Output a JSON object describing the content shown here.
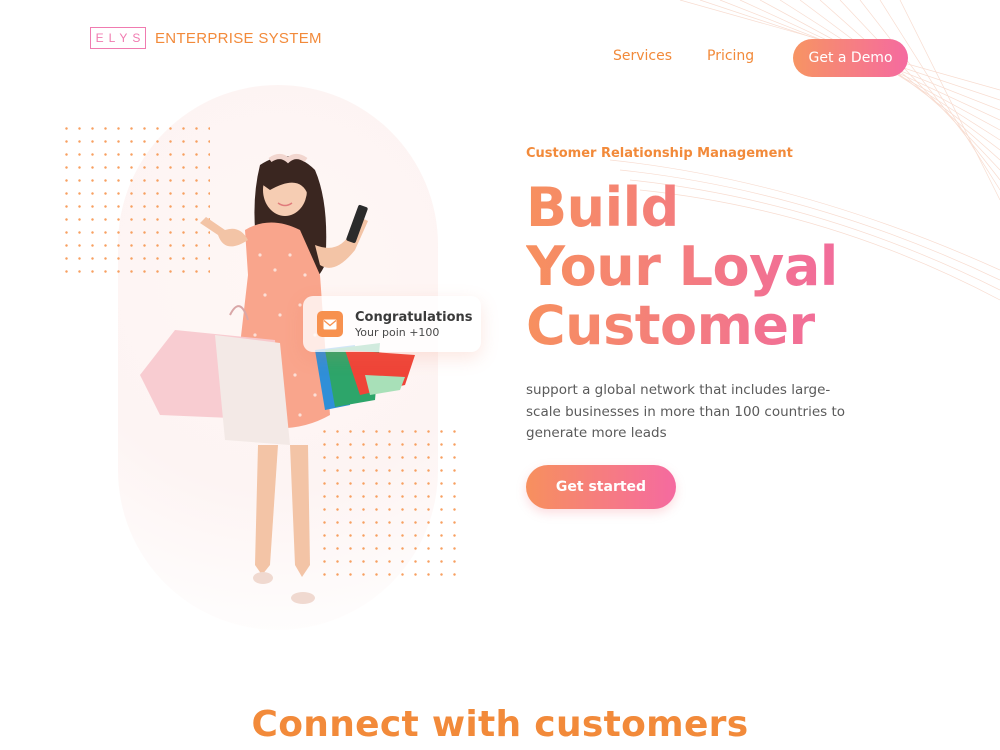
{
  "header": {
    "logo": "ELYS",
    "brand": "ENTERPRISE SYSTEM",
    "nav": {
      "services": "Services",
      "pricing": "Pricing"
    },
    "demo_button": "Get a Demo"
  },
  "notification": {
    "icon": "mail-icon",
    "title": "Congratulations",
    "subtitle": "Your poin +100"
  },
  "hero": {
    "eyebrow": "Customer Relationship Management",
    "headline": [
      "Build",
      "Your Loyal",
      "Customer"
    ],
    "description": "support a global network that includes large-scale businesses in more than 100 countries to generate more leads",
    "cta": "Get started"
  },
  "section": {
    "title": "Connect with customers"
  },
  "colors": {
    "orange": "#f28a3a",
    "pink": "#f56aa0",
    "gradient_start": "#f7905e"
  }
}
